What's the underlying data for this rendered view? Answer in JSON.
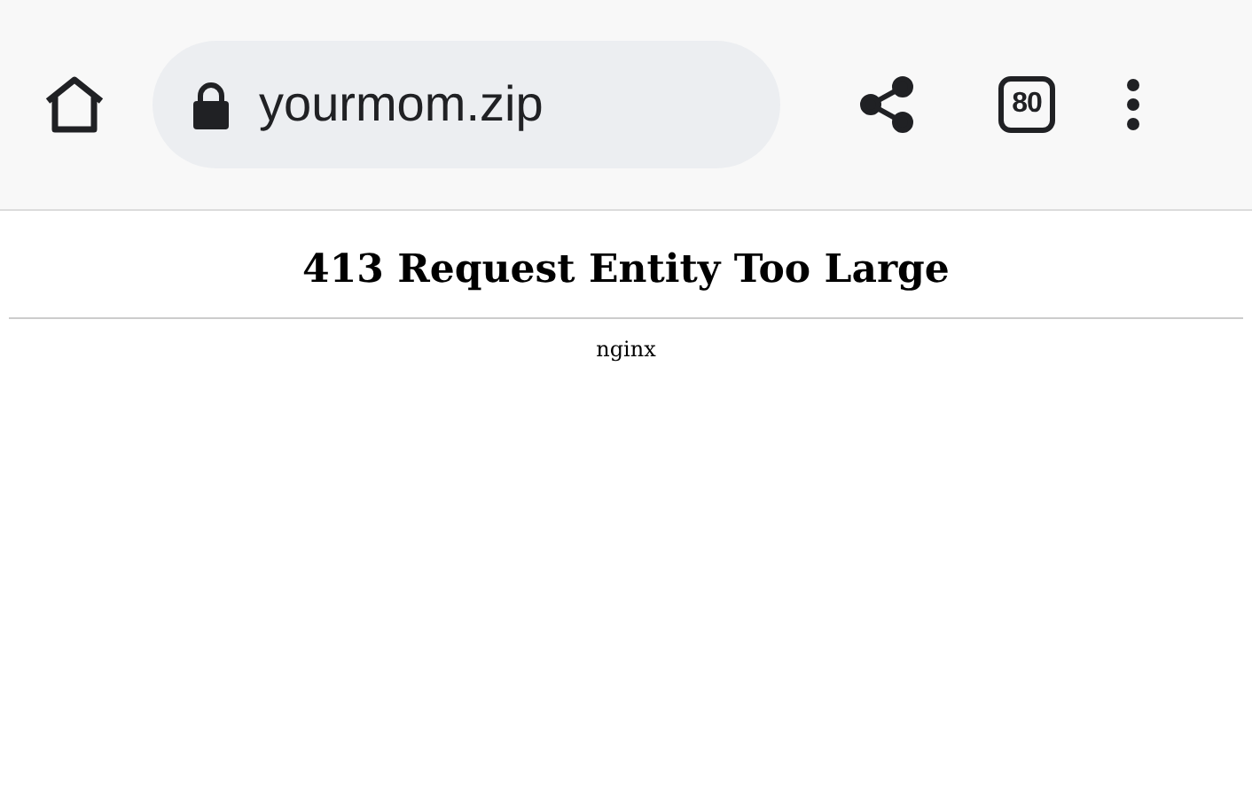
{
  "toolbar": {
    "url": "yourmom.zip",
    "tab_count": "80"
  },
  "page": {
    "heading": "413 Request Entity Too Large",
    "server": "nginx"
  }
}
